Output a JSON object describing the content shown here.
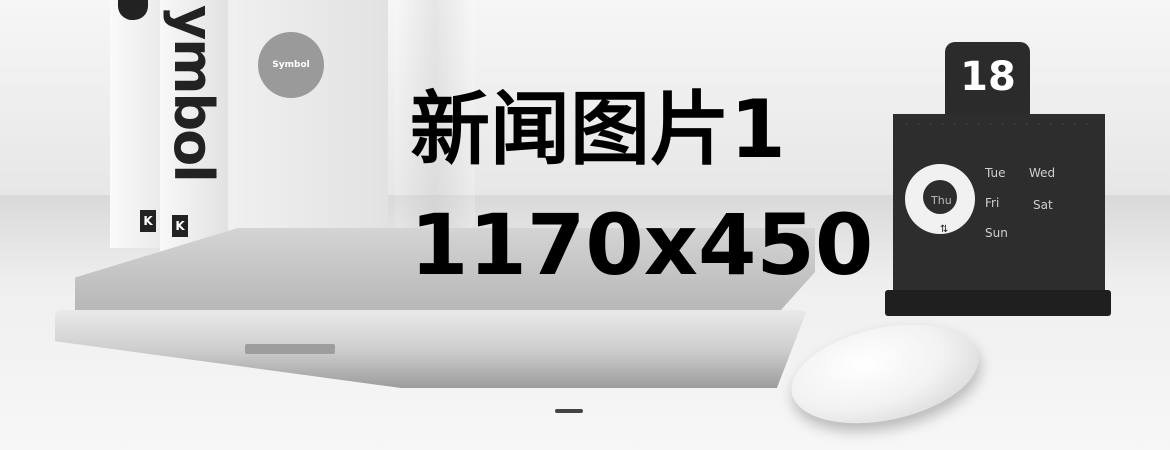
{
  "overlay": {
    "title": "新闻图片1",
    "dimensions": "1170x450"
  },
  "scene": {
    "book_spine_text": "ymbol",
    "book_k_label": "K",
    "sticker_text": "Symbol",
    "calendar": {
      "day_number": "18",
      "weekdays": {
        "tue": "Tue",
        "wed": "Wed",
        "thu": "Thu",
        "fri": "Fri",
        "sat": "Sat",
        "sun": "Sun"
      }
    }
  }
}
